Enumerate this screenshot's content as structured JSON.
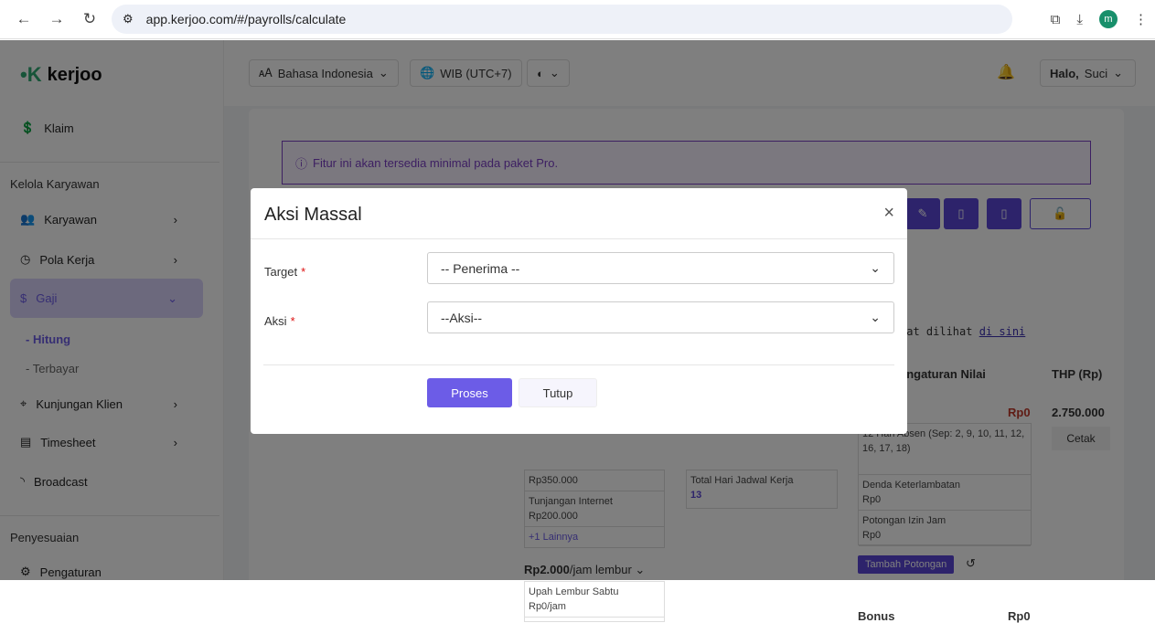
{
  "browser": {
    "url": "app.kerjoo.com/#/payrolls/calculate",
    "profile_initial": "m"
  },
  "brand": {
    "name": "kerjoo",
    "accent": "#6c5ce7"
  },
  "header": {
    "language": "Bahasa Indonesia",
    "timezone": "WIB (UTC+7)",
    "user_greeting": "Halo,",
    "user_name": "Suci"
  },
  "sidebar": {
    "klaim": "Klaim",
    "section1": "Kelola Karyawan",
    "items": [
      {
        "label": "Karyawan"
      },
      {
        "label": "Pola Kerja"
      },
      {
        "label": "Gaji"
      },
      {
        "label": "Kunjungan Klien"
      },
      {
        "label": "Timesheet"
      },
      {
        "label": "Broadcast"
      }
    ],
    "sub": [
      "Hitung",
      "Terbayar"
    ],
    "section2": "Penyesuaian",
    "pengaturan": "Pengaturan"
  },
  "main": {
    "alert": "Fitur ini akan tersedia minimal pada paket Pro.",
    "info_text": "pat dilihat ",
    "info_link": "di sini",
    "col_pengaturan": "engaturan Nilai",
    "col_thp": "THP (Rp)",
    "potongan_suffix": "n",
    "potongan_total": "Rp0",
    "thp_value": "2.750.000",
    "cetak": "Cetak",
    "absen": "12 Hari Absen (Sep: 2, 9, 10, 11, 12, 16, 17, 18)",
    "denda_label": "Denda Keterlambatan",
    "denda_value": "Rp0",
    "izin_label": "Potongan Izin Jam",
    "izin_value": "Rp0",
    "tambah_potongan": "Tambah Potongan",
    "bonus_label": "Bonus",
    "bonus_value": "Rp0",
    "tunjangan_prev_value": "Rp350.000",
    "internet_label": "Tunjangan Internet",
    "internet_value": "Rp200.000",
    "lainnya": "+1 Lainnya",
    "lembur_rate": "Rp2.000",
    "lembur_unit": "/jam lembur",
    "lembur_sabtu_label": "Upah Lembur Sabtu",
    "lembur_sabtu_value": "Rp0/jam",
    "jadwal_label": "Total Hari Jadwal Kerja",
    "jadwal_value": "13"
  },
  "modal": {
    "title": "Aksi Massal",
    "target_label": "Target",
    "target_value": "-- Penerima --",
    "aksi_label": "Aksi",
    "aksi_value": "--Aksi--",
    "required_mark": "*",
    "proses": "Proses",
    "tutup": "Tutup"
  }
}
